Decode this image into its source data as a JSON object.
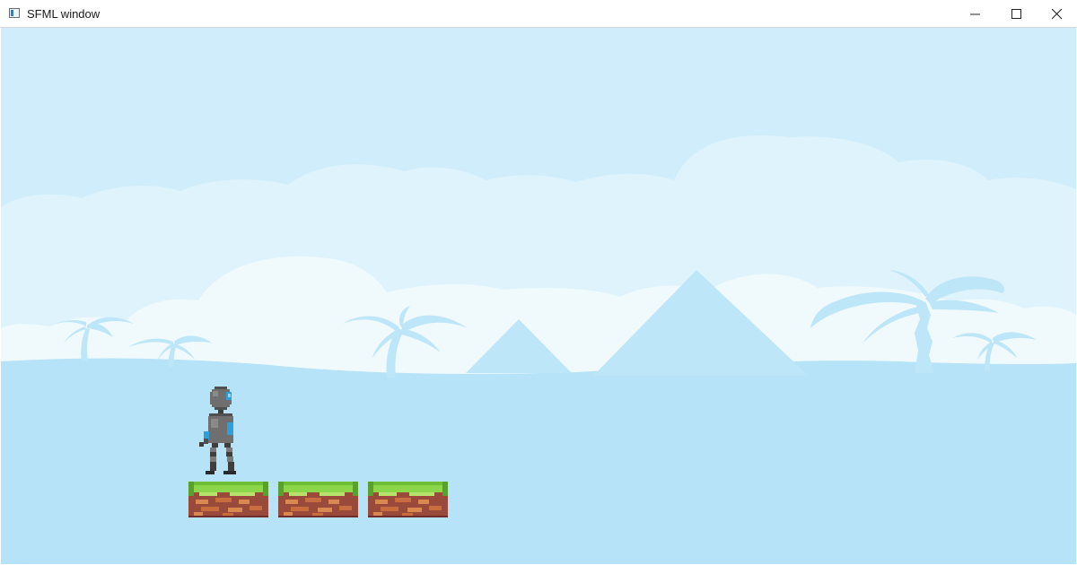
{
  "window": {
    "title": "SFML window",
    "controls": {
      "minimize_icon": "minimize-icon",
      "maximize_icon": "maximize-icon",
      "close_icon": "close-icon"
    }
  },
  "scene": {
    "colors": {
      "sky": "#cfedfa",
      "clouds_back": "#def3fc",
      "clouds_front": "#f0fafd",
      "silhouettes": "#bde6f8",
      "ground_haze": "#b6e3f7",
      "grass": "#8cd64a",
      "dirt": "#9a4a3a",
      "player_body": "#6f6f6f",
      "player_accent": "#2f9fdb"
    },
    "elements": {
      "player": "robot-character-sprite",
      "platforms": [
        "grass-dirt-tile",
        "grass-dirt-tile",
        "grass-dirt-tile"
      ]
    }
  }
}
